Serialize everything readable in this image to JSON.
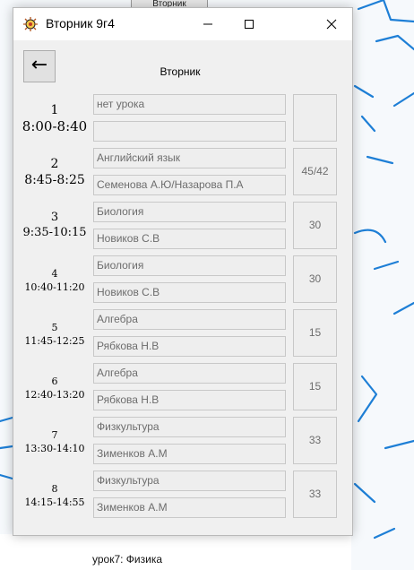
{
  "background": {
    "tab_label": "Вторник",
    "footer_text": "урок7: Физика"
  },
  "window": {
    "title": "Вторник 9г4",
    "back_button": "←",
    "day_label": "Вторник"
  },
  "lessons": [
    {
      "number": "1",
      "time": "8:00-8:40",
      "subject": "нет урока",
      "teacher": "",
      "room": ""
    },
    {
      "number": "2",
      "time": "8:45-8:25",
      "subject": "Английский язык",
      "teacher": "Семенова А.Ю/Назарова П.А",
      "room": "45/42"
    },
    {
      "number": "3",
      "time": "9:35-10:15",
      "subject": "Биология",
      "teacher": "Новиков С.В",
      "room": "30"
    },
    {
      "number": "4",
      "time": "10:40-11:20",
      "subject": "Биология",
      "teacher": "Новиков С.В",
      "room": "30"
    },
    {
      "number": "5",
      "time": "11:45-12:25",
      "subject": "Алгебра",
      "teacher": "Рябкова Н.В",
      "room": "15"
    },
    {
      "number": "6",
      "time": "12:40-13:20",
      "subject": "Алгебра",
      "teacher": "Рябкова Н.В",
      "room": "15"
    },
    {
      "number": "7",
      "time": "13:30-14:10",
      "subject": "Физкультура",
      "teacher": "Зименков А.М",
      "room": "33"
    },
    {
      "number": "8",
      "time": "14:15-14:55",
      "subject": "Физкультура",
      "teacher": "Зименков А.М",
      "room": "33"
    }
  ]
}
